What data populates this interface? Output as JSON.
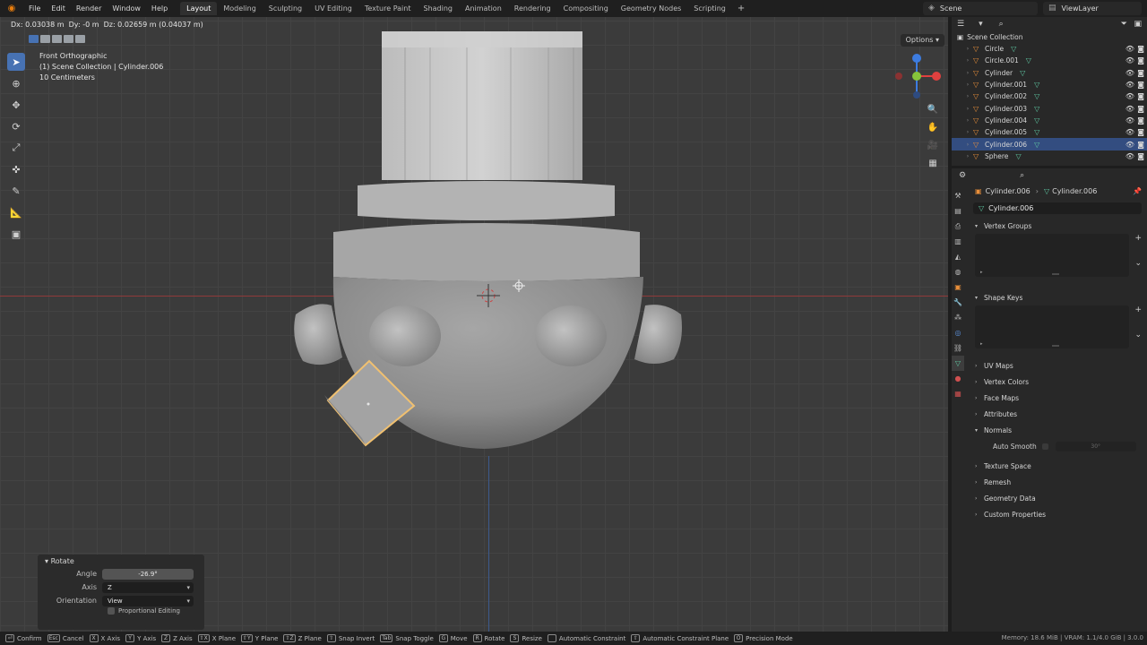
{
  "menubar": {
    "items": [
      "File",
      "Edit",
      "Render",
      "Window",
      "Help"
    ],
    "workspaces": [
      "Layout",
      "Modeling",
      "Sculpting",
      "UV Editing",
      "Texture Paint",
      "Shading",
      "Animation",
      "Rendering",
      "Compositing",
      "Geometry Nodes",
      "Scripting"
    ],
    "active_workspace": "Layout",
    "add_tab": "+",
    "scene": "Scene",
    "view_layer": "ViewLayer"
  },
  "viewport": {
    "readout": "Dx: 0.03038 m  Dy: -0 m  Dz: 0.02659 m (0.04037 m)",
    "view_name": "Front Orthographic",
    "collection_info": "(1) Scene Collection | Cylinder.006",
    "scale": "10 Centimeters",
    "options_label": "Options",
    "gizmo_colors": {
      "x": "#e0403f",
      "y": "#86c43b",
      "z": "#3d7ce0"
    }
  },
  "rotate_panel": {
    "title": "Rotate",
    "angle_label": "Angle",
    "angle_value": "-26.9°",
    "axis_label": "Axis",
    "axis_value": "Z",
    "orientation_label": "Orientation",
    "orientation_value": "View",
    "proportional_label": "Proportional Editing"
  },
  "statusbar": {
    "items": [
      {
        "key": "⏎",
        "label": "Confirm"
      },
      {
        "key": "Esc",
        "label": "Cancel"
      },
      {
        "key": "X",
        "label": "X Axis"
      },
      {
        "key": "Y",
        "label": "Y Axis"
      },
      {
        "key": "Z",
        "label": "Z Axis"
      },
      {
        "key": "⇧X",
        "label": "X Plane"
      },
      {
        "key": "⇧Y",
        "label": "Y Plane"
      },
      {
        "key": "⇧Z",
        "label": "Z Plane"
      },
      {
        "key": "⇧",
        "label": "Snap Invert"
      },
      {
        "key": "Tab",
        "label": "Snap Toggle"
      },
      {
        "key": "G",
        "label": "Move"
      },
      {
        "key": "R",
        "label": "Rotate"
      },
      {
        "key": "S",
        "label": "Resize"
      },
      {
        "key": "",
        "label": "Automatic Constraint"
      },
      {
        "key": "⇧",
        "label": "Automatic Constraint Plane"
      },
      {
        "key": "O",
        "label": "Precision Mode"
      }
    ],
    "memory": "Memory: 18.6 MiB | VRAM: 1.1/4.0 GiB | 3.0.0"
  },
  "outliner": {
    "collection": "Scene Collection",
    "items": [
      {
        "name": "Circle",
        "selected": false
      },
      {
        "name": "Circle.001",
        "selected": false
      },
      {
        "name": "Cylinder",
        "selected": false
      },
      {
        "name": "Cylinder.001",
        "selected": false
      },
      {
        "name": "Cylinder.002",
        "selected": false
      },
      {
        "name": "Cylinder.003",
        "selected": false
      },
      {
        "name": "Cylinder.004",
        "selected": false
      },
      {
        "name": "Cylinder.005",
        "selected": false
      },
      {
        "name": "Cylinder.006",
        "selected": true
      },
      {
        "name": "Sphere",
        "selected": false
      }
    ]
  },
  "properties": {
    "object_name": "Cylinder.006",
    "mesh_name": "Cylinder.006",
    "data_name": "Cylinder.006",
    "panels": {
      "vertex_groups": "Vertex Groups",
      "shape_keys": "Shape Keys",
      "uv_maps": "UV Maps",
      "vertex_colors": "Vertex Colors",
      "face_maps": "Face Maps",
      "attributes": "Attributes",
      "normals": "Normals",
      "auto_smooth": "Auto Smooth",
      "auto_smooth_angle": "30°",
      "texture_space": "Texture Space",
      "remesh": "Remesh",
      "geometry_data": "Geometry Data",
      "custom_properties": "Custom Properties"
    }
  }
}
